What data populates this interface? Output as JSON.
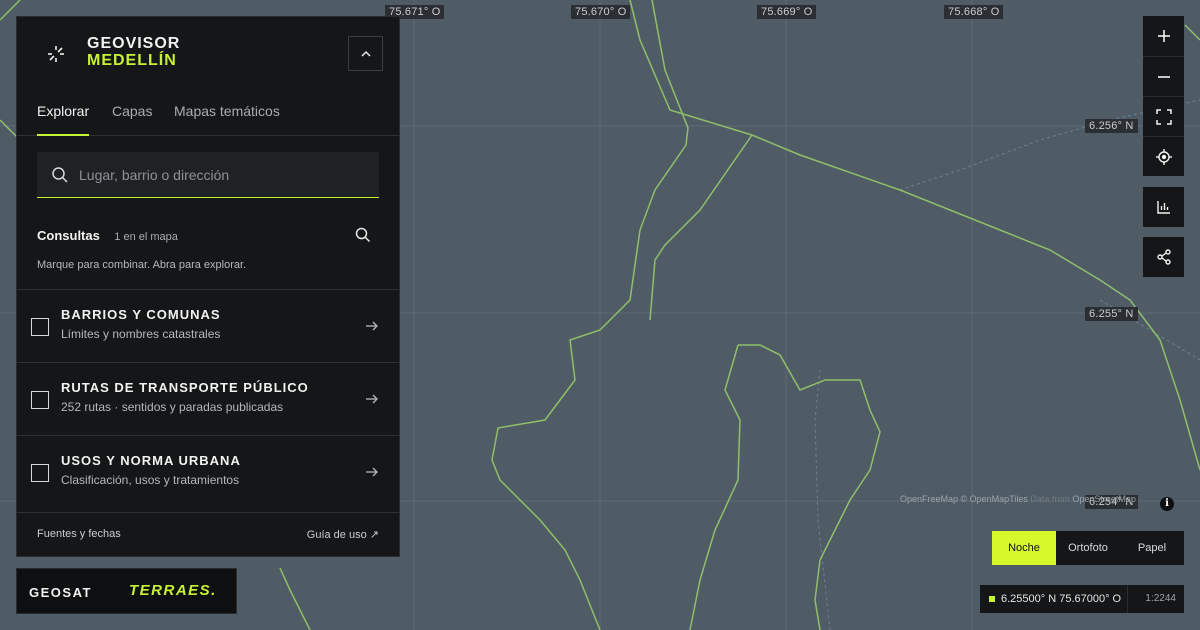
{
  "app": {
    "title_line1": "GEOVISOR",
    "title_line2": "MEDELLÍN"
  },
  "tabs": [
    {
      "label": "Explorar",
      "active": true
    },
    {
      "label": "Capas",
      "active": false
    },
    {
      "label": "Mapas temáticos",
      "active": false
    }
  ],
  "search": {
    "placeholder": "Lugar, barrio o dirección",
    "value": ""
  },
  "consultas": {
    "title": "Consultas",
    "count": "1 en el mapa",
    "hint": "Marque para combinar. Abra para explorar."
  },
  "layers": [
    {
      "name": "BARRIOS Y COMUNAS",
      "description": "Límites y nombres catastrales",
      "checked": false
    },
    {
      "name": "RUTAS DE TRANSPORTE PÚBLICO",
      "description": "252 rutas · sentidos y paradas publicadas",
      "checked": false
    },
    {
      "name": "USOS Y NORMA URBANA",
      "description": "Clasificación, usos y tratamientos",
      "checked": false
    }
  ],
  "footer": {
    "sources": "Fuentes y fechas",
    "guide": "Guía de uso ↗"
  },
  "logos": {
    "geosat": "GEOSAT",
    "terraes": "TERRAES."
  },
  "map": {
    "longitude_labels": [
      "75.671° O",
      "75.670° O",
      "75.669° O",
      "75.668° O"
    ],
    "latitude_labels": [
      "6.256° N",
      "6.255° N",
      "6.254° N"
    ],
    "attribution": "OpenFreeMap © OpenMapTiles",
    "attribution_dim": "Data from",
    "attribution_osm": "OpenStreetMap"
  },
  "basemaps": [
    {
      "label": "Noche",
      "active": true
    },
    {
      "label": "Ortofoto",
      "active": false
    },
    {
      "label": "Papel",
      "active": false
    }
  ],
  "status": {
    "coordinates": "6.25500° N 75.67000° O",
    "scale": "1:2244"
  },
  "colors": {
    "accent": "#c6f135",
    "panel": "#141617",
    "map_bg": "#4f5c66",
    "boundary": "#8fbf6a"
  }
}
